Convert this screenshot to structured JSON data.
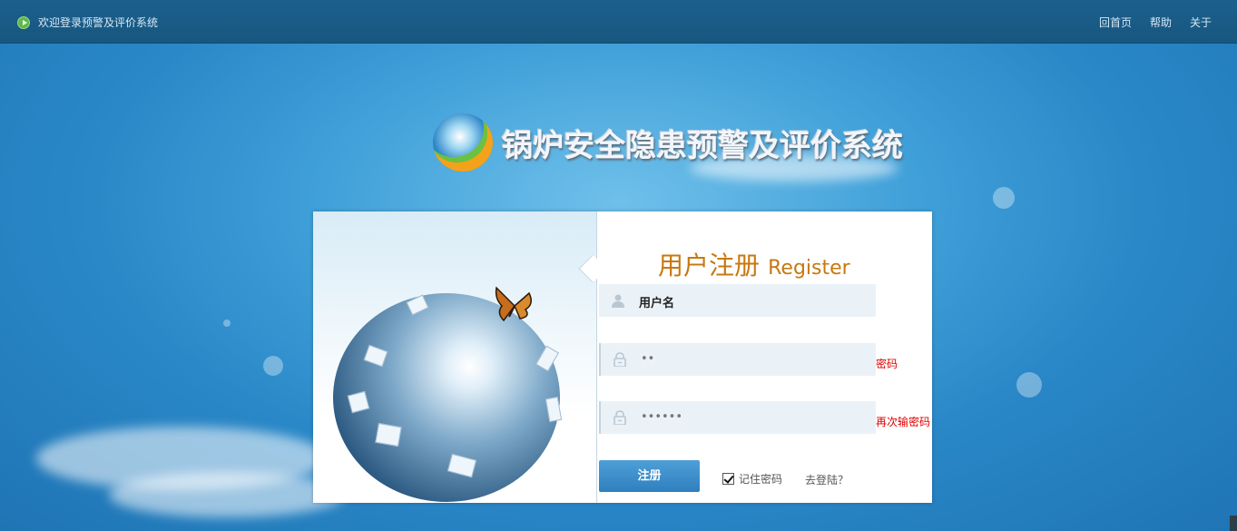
{
  "topbar": {
    "welcome": "欢迎登录预警及评价系统",
    "nav": [
      "回首页",
      "帮助",
      "关于"
    ]
  },
  "logo": {
    "title": "锅炉安全隐患预警及评价系统"
  },
  "register": {
    "title_cn": "用户注册",
    "title_en": "Register",
    "username_value": "用户名",
    "password_value": "••",
    "password_hint": "密码",
    "confirm_value": "••••••",
    "confirm_hint": "再次输密码",
    "submit_label": "注册",
    "remember_label": "记住密码",
    "remember_checked": true,
    "login_link": "去登陆？"
  },
  "colors": {
    "accent": "#c8780f",
    "button": "#3a8cc8",
    "hint": "#e00000",
    "topbar": "#1a5c8b"
  }
}
